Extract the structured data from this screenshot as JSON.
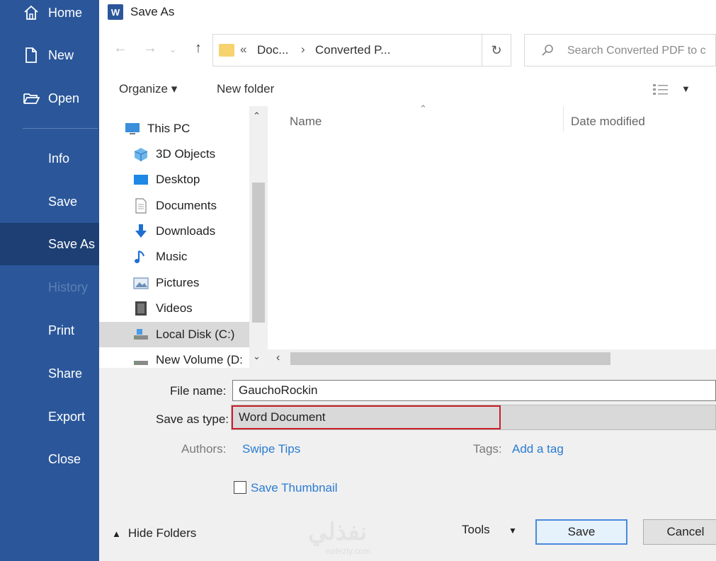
{
  "backstage": {
    "items": [
      {
        "label": "Home",
        "icon": "home-icon"
      },
      {
        "label": "New",
        "icon": "new-document-icon"
      },
      {
        "label": "Open",
        "icon": "open-folder-icon"
      },
      {
        "label": "Info"
      },
      {
        "label": "Save"
      },
      {
        "label": "Save As",
        "selected": true
      },
      {
        "label": "History",
        "disabled": true
      },
      {
        "label": "Print"
      },
      {
        "label": "Share"
      },
      {
        "label": "Export"
      },
      {
        "label": "Close"
      }
    ],
    "bg_color": "#2b579a",
    "selected_color": "#1d3f73"
  },
  "dialog": {
    "title": "Save As",
    "app_icon": "word-icon",
    "address": {
      "prefix": "«",
      "crumbs": [
        "Doc...",
        "Converted P..."
      ],
      "separator": "›"
    },
    "search_placeholder": "Search Converted PDF to c",
    "toolbar": {
      "organize": "Organize ▾",
      "new_folder": "New folder"
    },
    "nav_tree": [
      {
        "label": "This PC",
        "icon": "this-pc-icon"
      },
      {
        "label": "3D Objects",
        "icon": "3d-objects-icon"
      },
      {
        "label": "Desktop",
        "icon": "desktop-icon"
      },
      {
        "label": "Documents",
        "icon": "documents-icon"
      },
      {
        "label": "Downloads",
        "icon": "downloads-icon"
      },
      {
        "label": "Music",
        "icon": "music-icon"
      },
      {
        "label": "Pictures",
        "icon": "pictures-icon"
      },
      {
        "label": "Videos",
        "icon": "videos-icon"
      },
      {
        "label": "Local Disk (C:)",
        "icon": "drive-icon",
        "selected": true
      },
      {
        "label": "New Volume (D:",
        "icon": "drive-icon"
      }
    ],
    "columns": {
      "name": "Name",
      "date_modified": "Date modified"
    },
    "form": {
      "file_name_label": "File name:",
      "file_name_value": "GauchoRockin",
      "save_type_label": "Save as type:",
      "save_type_value": "Word Document",
      "authors_label": "Authors:",
      "authors_value": "Swipe Tips",
      "tags_label": "Tags:",
      "tags_value": "Add a tag",
      "save_thumbnail_label": "Save Thumbnail",
      "highlight_color": "#c8202a"
    },
    "footer": {
      "hide_folders": "Hide Folders",
      "tools": "Tools",
      "save": "Save",
      "cancel": "Cancel"
    },
    "watermark": {
      "text": "نفذلي",
      "sub": "nafezly.com"
    }
  }
}
